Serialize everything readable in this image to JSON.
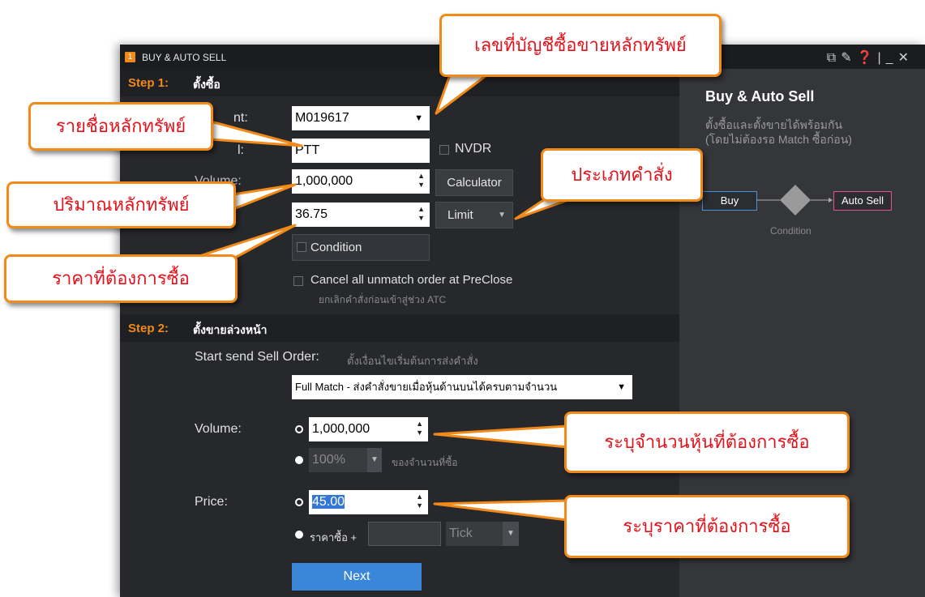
{
  "window": {
    "number": "1",
    "title": "BUY & AUTO SELL",
    "controls": [
      "popout-icon",
      "pin-icon",
      "help-icon",
      "divider",
      "minimize-icon",
      "close-icon"
    ]
  },
  "sidebar": {
    "title": "Buy & Auto Sell",
    "desc_line1": "ตั้งซื้อและตั้งขายได้พร้อมกัน",
    "desc_line2": "(โดยไม่ต้องรอ Match ซื้อก่อน)",
    "flow": {
      "buy": "Buy",
      "condition": "Condition",
      "auto_sell": "Auto Sell"
    },
    "colors": {
      "buy_border": "#4a8fe0",
      "auto_sell_border": "#e0558f",
      "diamond": "#9a9a9a"
    }
  },
  "step1": {
    "step_label": "Step 1:",
    "title": "ตั้งซื้อ",
    "account_label": "nt:",
    "account_value": "M019617",
    "symbol_label": "l:",
    "symbol_value": "PTT",
    "nvdr_label": "NVDR",
    "volume_label": "Volume:",
    "volume_value": "1,000,000",
    "calculator_label": "Calculator",
    "price_value": "36.75",
    "order_type": "Limit",
    "condition_label": "Condition",
    "cancel_label": "Cancel all unmatch order at PreClose",
    "cancel_sub": "ยกเลิกคำสั่งก่อนเข้าสู่ช่วง ATC"
  },
  "step2": {
    "step_label": "Step 2:",
    "title": "ตั้งขายล่วงหน้า",
    "start_label": "Start send Sell Order:",
    "start_sub": "ตั้งเงื่อนไขเริ่มต้นการส่งคำสั่ง",
    "start_value": "Full Match - ส่งคำสั่งขายเมื่อหุ้นด้านบนได้ครบตามจำนวน",
    "volume_label": "Volume:",
    "volume_value": "1,000,000",
    "percent_value": "100%",
    "percent_sub": "ของจำนวนที่ซื้อ",
    "price_label": "Price:",
    "price_value": "45.00",
    "price_plus_label": "ราคาซื้อ +",
    "tick_label": "Tick",
    "next_label": "Next"
  },
  "callouts": {
    "account": "เลขที่บัญชีซื้อขายหลักทรัพย์",
    "symbol": "รายชื่อหลักทรัพย์",
    "volume": "ปริมาณหลักทรัพย์",
    "price": "ราคาที่ต้องการซื้อ",
    "order_type": "ประเภทคำสั่ง",
    "sell_volume": "ระบุจำนวนหุ้นที่ต้องการซื้อ",
    "sell_price": "ระบุราคาที่ต้องการซื้อ"
  },
  "colors": {
    "accent": "#f28a1a",
    "callout_text": "#e3121b",
    "next_button": "#3a86d8",
    "selection": "#3478d4"
  }
}
